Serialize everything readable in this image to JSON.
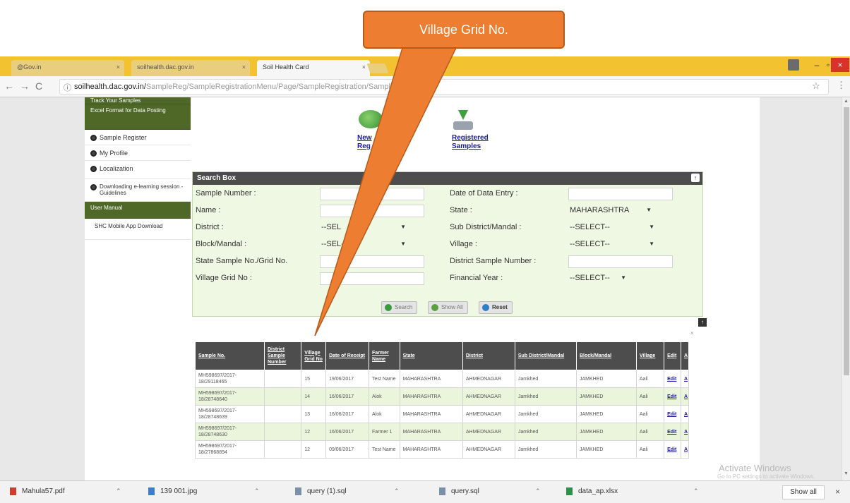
{
  "browser": {
    "tabs": [
      {
        "label": "@Gov.in"
      },
      {
        "label": "soilhealth.dac.gov.in"
      },
      {
        "label": "Soil Health Card"
      }
    ],
    "url_main": "soilhealth.dac.gov.in/",
    "url_dim": "SampleReg/SampleRegistrationMenu/Page/SampleRegistration/SampleNew"
  },
  "sidebar": {
    "items": [
      {
        "label": "Track Your Samples",
        "style": "green"
      },
      {
        "label": "Excel Format for Data Posting",
        "style": "green"
      },
      {
        "label": "Sample Register",
        "style": "bullet"
      },
      {
        "label": "My Profile",
        "style": "bullet"
      },
      {
        "label": "Localization",
        "style": "bullet"
      },
      {
        "label": "Downloading e-learning session - Guidelines",
        "style": "bullet"
      },
      {
        "label": "User Manual",
        "style": "green"
      },
      {
        "label": "SHC Mobile App Download",
        "style": "plain"
      }
    ]
  },
  "actions": {
    "new_line1": "New",
    "new_line2": "Reg",
    "registered_line1": "Registered",
    "registered_line2": "Samples"
  },
  "search": {
    "title": "Search Box",
    "sample_number": "Sample Number :",
    "name": "Name :",
    "district": "District :",
    "block_mandal": "Block/Mandal :",
    "state_sample_no": "State Sample No./Grid No.",
    "village_grid_no": "Village Grid No :",
    "date_of_entry": "Date of Data Entry :",
    "state": "State :",
    "sub_district": "Sub District/Mandal :",
    "village": "Village :",
    "district_sample_number": "District Sample Number :",
    "financial_year": "Financial Year :",
    "state_value": "MAHARASHTRA",
    "district_value": "--SEL",
    "block_value": "--SEL",
    "block_value_tail": "--",
    "sub_district_value": "--SELECT--",
    "village_value": "--SELECT--",
    "fy_value": "--SELECT--",
    "btn_search": "Search",
    "btn_show_all": "Show All",
    "btn_reset": "Reset"
  },
  "table": {
    "headers": [
      "Sample No.",
      "District Sample Number",
      "Village Grid No",
      "Date of Receipt",
      "Farmer Name",
      "State",
      "District",
      "Sub District/Mandal",
      "Block/Mandal",
      "Village",
      "Edit",
      "A"
    ],
    "rows": [
      [
        "MH598697/2017-18/29118465",
        "",
        "15",
        "19/06/2017",
        "Test Name",
        "MAHARASHTRA",
        "AHMEDNAGAR",
        "Jamkhed",
        "JAMKHED",
        "Aali",
        "Edit",
        "A"
      ],
      [
        "MH598697/2017-18/28748640",
        "",
        "14",
        "16/06/2017",
        "Alok",
        "MAHARASHTRA",
        "AHMEDNAGAR",
        "Jamkhed",
        "JAMKHED",
        "Aali",
        "Edit",
        "A"
      ],
      [
        "MH598697/2017-18/28748639",
        "",
        "13",
        "16/06/2017",
        "Alok",
        "MAHARASHTRA",
        "AHMEDNAGAR",
        "Jamkhed",
        "JAMKHED",
        "Aali",
        "Edit",
        "A"
      ],
      [
        "MH598697/2017-18/28748630",
        "",
        "12",
        "16/06/2017",
        "Farmer 1",
        "MAHARASHTRA",
        "AHMEDNAGAR",
        "Jamkhed",
        "JAMKHED",
        "Aali",
        "Edit",
        "A"
      ],
      [
        "MH598697/2017-18/27868894",
        "",
        "12",
        "09/06/2017",
        "Test Name",
        "MAHARASHTRA",
        "AHMEDNAGAR",
        "Jamkhed",
        "JAMKHED",
        "Aali",
        "Edit",
        "A"
      ]
    ]
  },
  "watermark": {
    "line1": "Activate Windows",
    "line2": "Go to PC settings to activate Windows."
  },
  "downloads": {
    "items": [
      {
        "label": "Mahula57.pdf",
        "color": "#d23b2f"
      },
      {
        "label": "139 001.jpg",
        "color": "#3c7fc6"
      },
      {
        "label": "query (1).sql",
        "color": "#7b8fa8"
      },
      {
        "label": "query.sql",
        "color": "#7b8fa8"
      },
      {
        "label": "data_ap.xlsx",
        "color": "#2f8f4a"
      }
    ],
    "show_all": "Show all"
  },
  "callout": {
    "label": "Village Grid No.",
    "color": "#ed7d31"
  }
}
